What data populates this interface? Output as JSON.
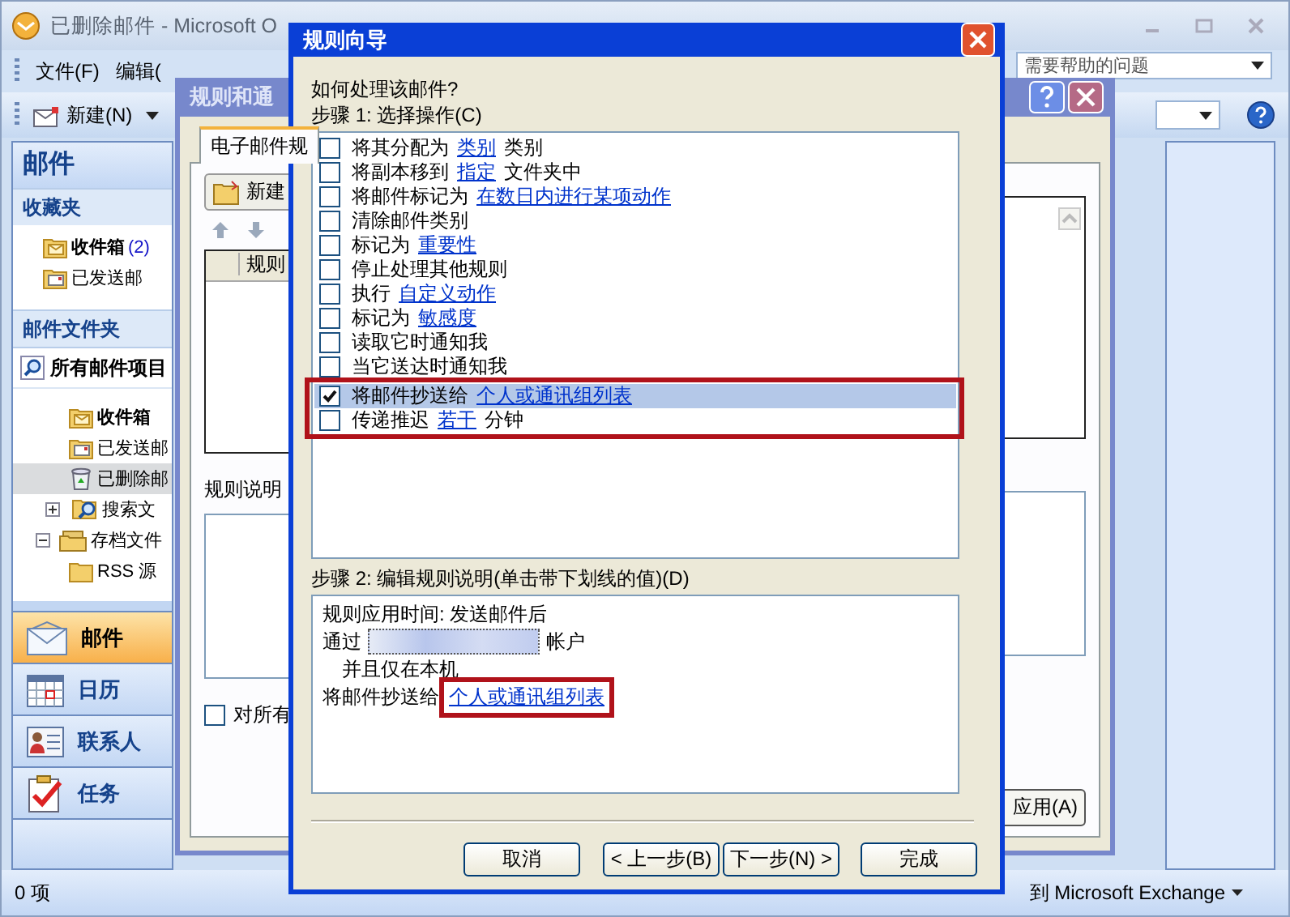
{
  "outlook": {
    "title": "已删除邮件 - Microsoft O",
    "menu": [
      "文件(F)",
      "编辑("
    ],
    "help_search": {
      "value": "需要帮助的问题"
    },
    "new_button": "新建(N)",
    "nav": {
      "header": "邮件",
      "favorites_title": "收藏夹",
      "favorites": [
        {
          "label": "收件箱",
          "count": "(2)",
          "unread": true
        },
        {
          "label": "已发送邮",
          "unread": false
        }
      ],
      "folders_title": "邮件文件夹",
      "all_items": "所有邮件项目",
      "mailbox_folders": [
        {
          "label": "收件箱",
          "unread": true,
          "selected": false
        },
        {
          "label": "已发送邮",
          "unread": false,
          "selected": false
        },
        {
          "label": "已删除邮",
          "unread": false,
          "selected": true
        },
        {
          "label": "搜索文",
          "unread": false,
          "selected": false,
          "expanded": false
        }
      ],
      "archive": {
        "label": "存档文件",
        "expanded": true,
        "children": [
          {
            "label": "RSS 源",
            "unread": false,
            "selected": false
          }
        ]
      },
      "buttons": [
        {
          "label": "邮件",
          "selected": true
        },
        {
          "label": "日历",
          "selected": false
        },
        {
          "label": "联系人",
          "selected": false
        },
        {
          "label": "任务",
          "selected": false
        }
      ]
    },
    "status_bar": {
      "items": "0 项",
      "connection": "到 Microsoft Exchange"
    }
  },
  "rules_dialog": {
    "title": "规则和通",
    "tab": "电子邮件规",
    "new_button": "新建",
    "column": "规则",
    "description_label": "规则说明",
    "apply_all": {
      "label": "对所有",
      "checked": false
    },
    "apply_button": "应用(A)"
  },
  "wizard": {
    "title": "规则向导",
    "question": "如何处理该邮件?",
    "step1_label": "步骤 1: 选择操作(C)",
    "actions": [
      {
        "checked": false,
        "selected": false,
        "highlight": false,
        "parts": [
          {
            "kind": "text",
            "text": "将其分配为"
          },
          {
            "kind": "link",
            "text": "类别"
          },
          {
            "kind": "text",
            "text": "类别"
          }
        ]
      },
      {
        "checked": false,
        "selected": false,
        "highlight": false,
        "parts": [
          {
            "kind": "text",
            "text": "将副本移到"
          },
          {
            "kind": "link",
            "text": "指定"
          },
          {
            "kind": "text",
            "text": "文件夹中"
          }
        ]
      },
      {
        "checked": false,
        "selected": false,
        "highlight": false,
        "parts": [
          {
            "kind": "text",
            "text": "将邮件标记为"
          },
          {
            "kind": "link",
            "text": "在数日内进行某项动作"
          }
        ]
      },
      {
        "checked": false,
        "selected": false,
        "highlight": false,
        "parts": [
          {
            "kind": "text",
            "text": "清除邮件类别"
          }
        ]
      },
      {
        "checked": false,
        "selected": false,
        "highlight": false,
        "parts": [
          {
            "kind": "text",
            "text": "标记为"
          },
          {
            "kind": "link",
            "text": "重要性"
          }
        ]
      },
      {
        "checked": false,
        "selected": false,
        "highlight": false,
        "parts": [
          {
            "kind": "text",
            "text": "停止处理其他规则"
          }
        ]
      },
      {
        "checked": false,
        "selected": false,
        "highlight": false,
        "parts": [
          {
            "kind": "text",
            "text": "执行"
          },
          {
            "kind": "link",
            "text": "自定义动作"
          }
        ]
      },
      {
        "checked": false,
        "selected": false,
        "highlight": false,
        "parts": [
          {
            "kind": "text",
            "text": "标记为"
          },
          {
            "kind": "link",
            "text": "敏感度"
          }
        ]
      },
      {
        "checked": false,
        "selected": false,
        "highlight": false,
        "parts": [
          {
            "kind": "text",
            "text": "读取它时通知我"
          }
        ]
      },
      {
        "checked": false,
        "selected": false,
        "highlight": false,
        "parts": [
          {
            "kind": "text",
            "text": "当它送达时通知我"
          }
        ]
      },
      {
        "checked": true,
        "selected": true,
        "highlight": true,
        "parts": [
          {
            "kind": "text",
            "text": "将邮件抄送给"
          },
          {
            "kind": "link",
            "text": "个人或通讯组列表"
          }
        ]
      },
      {
        "checked": false,
        "selected": false,
        "highlight": true,
        "parts": [
          {
            "kind": "text",
            "text": "传递推迟"
          },
          {
            "kind": "link",
            "text": "若干"
          },
          {
            "kind": "text",
            "text": "分钟"
          }
        ]
      }
    ],
    "step2_label": "步骤 2: 编辑规则说明(单击带下划线的值)(D)",
    "description": [
      {
        "kind": "line",
        "parts": [
          {
            "kind": "text",
            "text": "规则应用时间: 发送邮件后"
          }
        ]
      },
      {
        "kind": "line",
        "parts": [
          {
            "kind": "text",
            "text": "通过"
          },
          {
            "kind": "redacted"
          },
          {
            "kind": "text",
            "text": "帐户"
          }
        ]
      },
      {
        "kind": "continuation",
        "parts": [
          {
            "kind": "text",
            "text": "并且仅在本机"
          }
        ]
      },
      {
        "kind": "line",
        "parts": [
          {
            "kind": "text",
            "text": "将邮件抄送给"
          },
          {
            "kind": "link",
            "text": "个人或通讯组列表",
            "highlight": true
          }
        ]
      }
    ],
    "buttons": [
      {
        "label": "取消"
      },
      {
        "label": "< 上一步(B)"
      },
      {
        "label": "下一步(N) >"
      },
      {
        "label": "完成"
      }
    ]
  }
}
